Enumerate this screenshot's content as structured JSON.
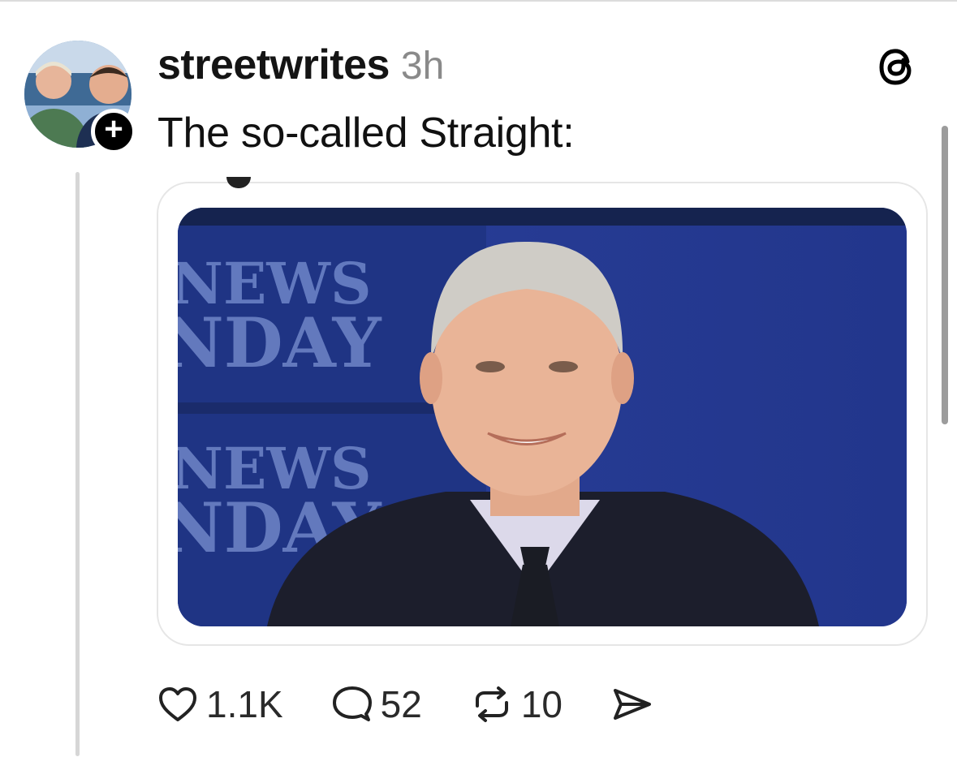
{
  "post": {
    "username": "streetwrites",
    "timestamp": "3h",
    "text": "The so-called Straight:",
    "follow_symbol": "+"
  },
  "media": {
    "backdrop_lines": [
      "NEWS",
      "NDAY",
      "NEWS",
      "NDAY"
    ]
  },
  "actions": {
    "likes": "1.1K",
    "replies": "52",
    "reposts": "10"
  },
  "icons": {
    "brand": "threads-logo-icon",
    "like": "heart-icon",
    "reply": "comment-bubble-icon",
    "repost": "repost-arrows-icon",
    "share": "send-icon"
  },
  "colors": {
    "backdrop_blue": "#263b95",
    "text": "#111111",
    "muted": "#8a8a8a"
  }
}
